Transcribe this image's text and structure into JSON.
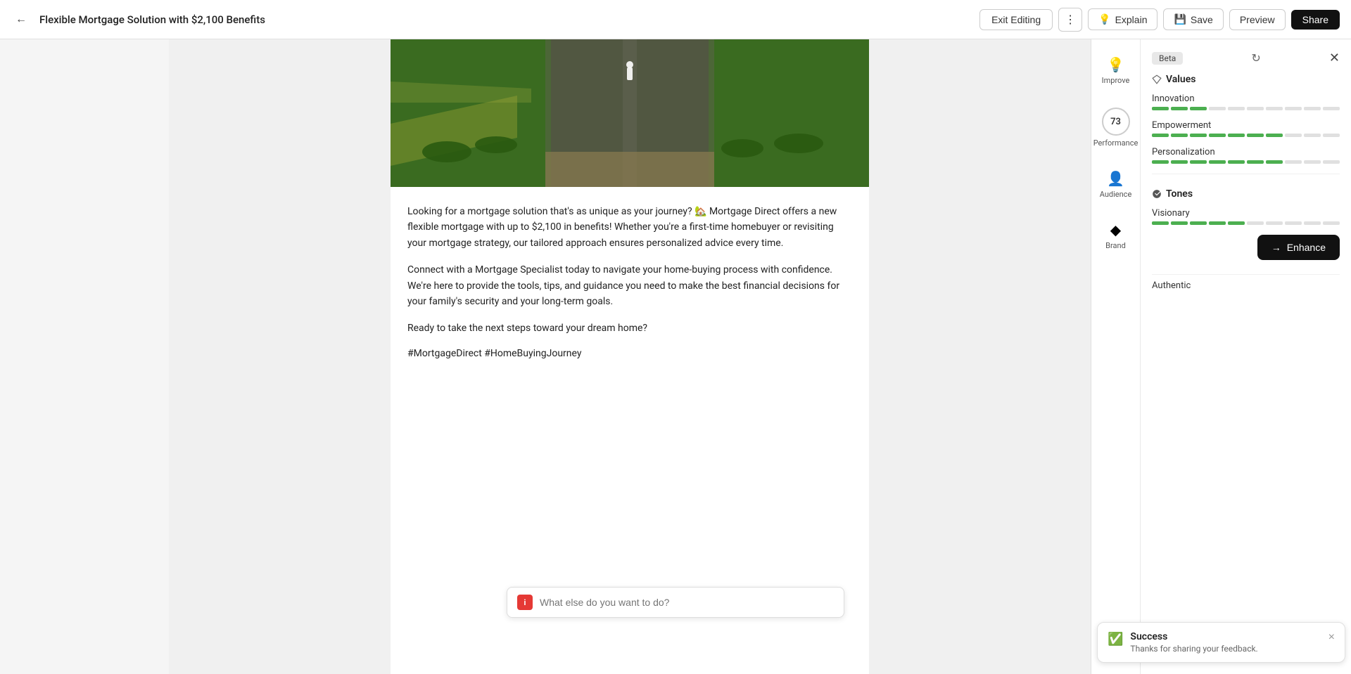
{
  "topbar": {
    "back_icon": "←",
    "title": "Flexible Mortgage Solution with $2,100 Benefits",
    "exit_editing_label": "Exit Editing",
    "more_icon": "⋮",
    "explain_icon": "💡",
    "explain_label": "Explain",
    "save_icon": "💾",
    "save_label": "Save",
    "preview_label": "Preview",
    "share_label": "Share"
  },
  "content": {
    "paragraph1": "Looking for a mortgage solution that's as unique as your journey? 🏡 Mortgage Direct offers a new flexible mortgage with up to $2,100 in benefits! Whether you're a first-time homebuyer or revisiting your mortgage strategy, our tailored approach ensures personalized advice every time.",
    "paragraph2": "Connect with a Mortgage Specialist today to navigate your home-buying process with confidence. We're here to provide the tools, tips, and guidance you need to make the best financial decisions for your family's security and your long-term goals.",
    "paragraph3": "Ready to take the next steps toward your dream home?",
    "hashtags": "#MortgageDirect #HomeBuyingJourney"
  },
  "right_panel": {
    "beta_label": "Beta",
    "icon_bar": [
      {
        "id": "improve",
        "icon": "💡",
        "label": "Improve"
      },
      {
        "id": "performance",
        "icon": "73",
        "label": "Performance"
      },
      {
        "id": "audience",
        "icon": "👤",
        "label": "Audience"
      },
      {
        "id": "brand",
        "icon": "◆",
        "label": "Brand"
      }
    ],
    "values_title": "Values",
    "values": [
      {
        "name": "Innovation",
        "filled": 3,
        "total": 10
      },
      {
        "name": "Empowerment",
        "filled": 7,
        "total": 10
      },
      {
        "name": "Personalization",
        "filled": 7,
        "total": 10
      }
    ],
    "tones_title": "Tones",
    "tones": [
      {
        "name": "Visionary",
        "filled": 5,
        "total": 10
      }
    ],
    "enhance_icon": "→",
    "enhance_label": "Enhance",
    "authentic_label": "Authentic"
  },
  "chat": {
    "placeholder": "What else do you want to do?",
    "icon_label": "i"
  },
  "toast": {
    "title": "Success",
    "subtitle": "Thanks for sharing your feedback.",
    "close_icon": "×"
  }
}
